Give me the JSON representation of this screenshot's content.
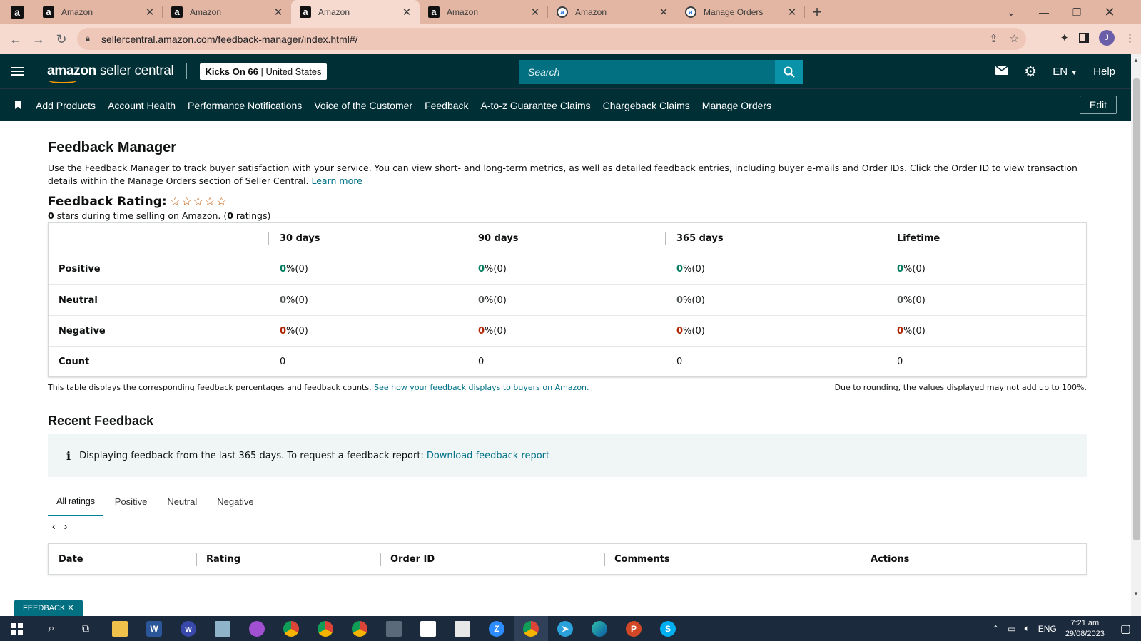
{
  "browser": {
    "tabs": [
      {
        "title": "Amazon",
        "favicon": "amazon-a",
        "active": false
      },
      {
        "title": "Amazon",
        "favicon": "amazon-a",
        "active": false
      },
      {
        "title": "Amazon",
        "favicon": "amazon-a",
        "active": true
      },
      {
        "title": "Amazon",
        "favicon": "amazon-a",
        "active": false
      },
      {
        "title": "Amazon",
        "favicon": "amazon-round",
        "active": false
      },
      {
        "title": "Manage Orders",
        "favicon": "amazon-round",
        "active": false
      }
    ],
    "url": "sellercentral.amazon.com/feedback-manager/index.html#/",
    "profile_initial": "J"
  },
  "header": {
    "logo_main": "amazon",
    "logo_sub": " seller central",
    "store_name": "Kicks On 66",
    "store_region": " | United States",
    "search_placeholder": "Search",
    "language": "EN",
    "help": "Help"
  },
  "nav": {
    "items": [
      "Add Products",
      "Account Health",
      "Performance Notifications",
      "Voice of the Customer",
      "Feedback",
      "A-to-z Guarantee Claims",
      "Chargeback Claims",
      "Manage Orders"
    ],
    "edit": "Edit"
  },
  "page": {
    "title": "Feedback Manager",
    "description": "Use the Feedback Manager to track buyer satisfaction with your service. You can view short- and long-term metrics, as well as detailed feedback entries, including buyer e-mails and Order IDs. Click the Order ID to view transaction details within the Manage Orders section of Seller Central. ",
    "learn_more": "Learn more",
    "rating_label": "Feedback Rating:",
    "stars": "☆☆☆☆☆",
    "rating_count_stars": "0",
    "rating_sub_mid": " stars during time selling on Amazon. (",
    "rating_count_ratings": "0",
    "rating_sub_end": " ratings)"
  },
  "feedback_table": {
    "columns": [
      "",
      "30 days",
      "90 days",
      "365 days",
      "Lifetime"
    ],
    "rows": [
      {
        "label": "Positive",
        "kind": "pos",
        "values": [
          "0",
          "0",
          "0",
          "0"
        ],
        "suffix": " %(0)"
      },
      {
        "label": "Neutral",
        "kind": "neu",
        "values": [
          "0",
          "0",
          "0",
          "0"
        ],
        "suffix": " %(0)"
      },
      {
        "label": "Negative",
        "kind": "neg",
        "values": [
          "0",
          "0",
          "0",
          "0"
        ],
        "suffix": " %(0)"
      },
      {
        "label": "Count",
        "kind": "count",
        "values": [
          "0",
          "0",
          "0",
          "0"
        ],
        "suffix": ""
      }
    ],
    "note_left": "This table displays the corresponding feedback percentages and feedback counts. ",
    "note_link": "See how your feedback displays to buyers on Amazon.",
    "note_right": "Due to rounding, the values displayed may not add up to 100%."
  },
  "recent": {
    "title": "Recent Feedback",
    "info_text": "Displaying feedback from the last 365 days. To request a feedback report: ",
    "info_link": "Download feedback report",
    "tabs": [
      "All ratings",
      "Positive",
      "Neutral",
      "Negative"
    ],
    "active_tab": "All ratings",
    "columns": [
      "Date",
      "Rating",
      "Order ID",
      "Comments",
      "Actions"
    ]
  },
  "feedback_pill": "FEEDBACK ✕",
  "taskbar": {
    "language": "ENG",
    "time": "7:21 am",
    "date": "29/08/2023"
  },
  "colors": {
    "header_bg": "#002f36",
    "accent": "#007185",
    "positive": "#067d62",
    "negative": "#b12704",
    "tab_strip": "#e3b6a3"
  }
}
